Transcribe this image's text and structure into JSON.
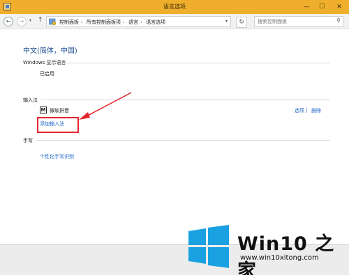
{
  "window": {
    "title": "语言选项",
    "min_glyph": "—",
    "max_glyph": "☐",
    "close_glyph": "✕"
  },
  "address_bar": {
    "back_glyph": "←",
    "forward_glyph": "→",
    "history_glyph": "▾",
    "up_glyph": "↑",
    "breadcrumb": [
      "控制面板",
      "所有控制面板项",
      "语言",
      "语言选项"
    ],
    "separator": "›",
    "dropdown_glyph": "▾",
    "refresh_glyph": "↻",
    "search_placeholder": "搜索控制面板",
    "search_glyph": "⚲"
  },
  "main": {
    "language_heading": "中文(简体，中国)",
    "display_language": {
      "title": "Windows 显示语言",
      "status": "已启用"
    },
    "input_method": {
      "title": "输入法",
      "ime_badge": "M",
      "ime_name": "微软拼音",
      "options_link": "选项",
      "divider": "|",
      "remove_link": "删除",
      "add_link": "添加输入法"
    },
    "handwriting": {
      "title": "手写",
      "personalize_link": "个性化手写识别"
    }
  },
  "watermark": {
    "brand": "Win10 之家",
    "site": "www.win10xitong.com"
  },
  "colors": {
    "titlebar": "#efaf2c",
    "link": "#1b63c9",
    "heading": "#1e4f96",
    "annotation": "#e3262e",
    "logo_blue": "#1aa1e1"
  }
}
